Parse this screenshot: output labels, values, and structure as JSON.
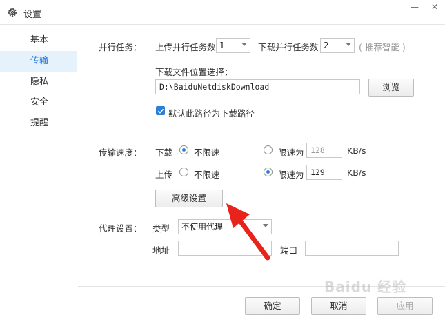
{
  "window": {
    "title": "设置",
    "minimize": "—",
    "close": "✕"
  },
  "sidebar": {
    "items": [
      {
        "label": "基本"
      },
      {
        "label": "传输"
      },
      {
        "label": "隐私"
      },
      {
        "label": "安全"
      },
      {
        "label": "提醒"
      }
    ]
  },
  "parallel": {
    "label": "并行任务：",
    "upload_label": "上传并行任务数",
    "upload_value": "1",
    "download_label": "下载并行任务数",
    "download_value": "2",
    "hint": "( 推荐智能 )"
  },
  "location": {
    "label": "下载文件位置选择：",
    "path": "D:\\BaiduNetdiskDownload",
    "browse": "浏览",
    "default_checkbox": "默认此路径为下载路径"
  },
  "speed": {
    "label": "传输速度：",
    "download_label": "下载",
    "upload_label": "上传",
    "unlimited": "不限速",
    "limit_to": "限速为",
    "download_limit": "128",
    "upload_limit": "129",
    "unit": "KB/s",
    "advanced": "高级设置"
  },
  "proxy": {
    "label": "代理设置：",
    "type_label": "类型",
    "type_value": "不使用代理",
    "address_label": "地址",
    "port_label": "端口"
  },
  "footer": {
    "ok": "确定",
    "cancel": "取消",
    "apply": "应用"
  },
  "colors": {
    "accent": "#2b7fd9",
    "arrow": "#e8231c",
    "sidebar_active_bg": "#e5f2fc"
  },
  "watermark": "Baidu 经验"
}
